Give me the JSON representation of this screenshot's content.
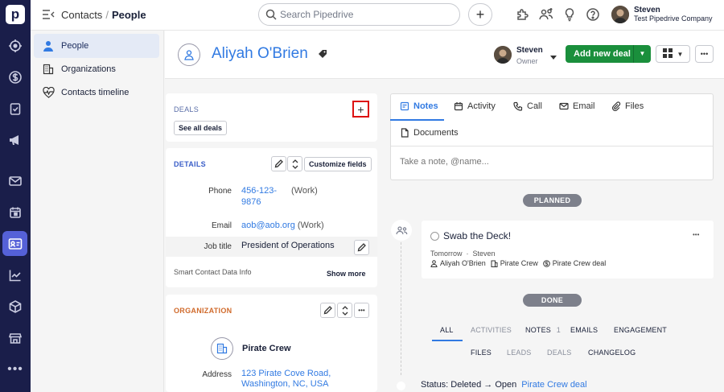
{
  "colors": {
    "rail_bg": "#1a1e4a",
    "rail_active": "#5561d8",
    "link_blue": "#317ae2",
    "primary_green": "#1a8f3c",
    "highlight_red": "#d11"
  },
  "rail": {
    "logo": "p",
    "icons": [
      "target-icon",
      "dollar-icon",
      "clipboard-check-icon",
      "megaphone-icon",
      "mail-icon",
      "calendar-icon",
      "contacts-card-icon",
      "chart-line-icon",
      "box-icon",
      "store-icon",
      "more-icon"
    ],
    "more": "•••"
  },
  "header": {
    "breadcrumb_parent": "Contacts",
    "breadcrumb_sep": "/",
    "breadcrumb_current": "People",
    "search_placeholder": "Search Pipedrive",
    "add_label": "+",
    "user_name": "Steven",
    "user_company": "Test Pipedrive Company"
  },
  "sidebar": {
    "items": [
      {
        "label": "People",
        "icon": "person-icon",
        "active": true
      },
      {
        "label": "Organizations",
        "icon": "building-icon",
        "active": false
      },
      {
        "label": "Contacts timeline",
        "icon": "heart-pulse-icon",
        "active": false
      }
    ]
  },
  "person": {
    "name": "Aliyah O'Brien",
    "owner_name": "Steven",
    "owner_role": "Owner",
    "add_deal_label": "Add new deal",
    "more_label": "•••"
  },
  "deals": {
    "title": "DEALS",
    "add": "+",
    "see_all": "See all deals"
  },
  "details": {
    "title": "DETAILS",
    "customize": "Customize fields",
    "phone_label": "Phone",
    "phone_value_line1": "456-123-",
    "phone_value_line2": "9876",
    "phone_type": "(Work)",
    "email_label": "Email",
    "email_value": "aob@aob.org",
    "email_type": "(Work)",
    "job_label": "Job title",
    "job_value": "President of Operations",
    "smart_label": "Smart Contact Data Info",
    "show_more": "Show more"
  },
  "organization": {
    "title": "ORGANIZATION",
    "name": "Pirate Crew",
    "address_label": "Address",
    "address_line1": "123 Pirate Cove Road,",
    "address_line2": "Washington, NC, USA"
  },
  "composer": {
    "tabs": [
      {
        "label": "Notes",
        "icon": "note-icon",
        "active": true
      },
      {
        "label": "Activity",
        "icon": "calendar-icon",
        "active": false
      },
      {
        "label": "Call",
        "icon": "phone-icon",
        "active": false
      },
      {
        "label": "Email",
        "icon": "envelope-icon",
        "active": false
      },
      {
        "label": "Files",
        "icon": "paperclip-icon",
        "active": false
      },
      {
        "label": "Documents",
        "icon": "document-icon",
        "active": false
      }
    ],
    "placeholder": "Take a note, @name..."
  },
  "timeline": {
    "planned_label": "PLANNED",
    "done_label": "DONE",
    "activity": {
      "title": "Swab the Deck!",
      "when": "Tomorrow",
      "dot": "·",
      "assignee": "Steven",
      "person": "Aliyah O'Brien",
      "org": "Pirate Crew",
      "deal": "Pirate Crew deal",
      "more": "•••"
    },
    "filters_row1": [
      {
        "label": "ALL",
        "active": true
      },
      {
        "label": "ACTIVITIES",
        "active": false
      },
      {
        "label": "NOTES",
        "count": "1",
        "active": true
      },
      {
        "label": "EMAILS",
        "active": true
      },
      {
        "label": "ENGAGEMENT",
        "active": true
      }
    ],
    "filters_row2": [
      {
        "label": "FILES",
        "active": true
      },
      {
        "label": "LEADS",
        "active": false
      },
      {
        "label": "DEALS",
        "active": false
      },
      {
        "label": "CHANGELOG",
        "active": true
      }
    ],
    "status_text": "Status: Deleted → Open",
    "status_link": "Pirate Crew deal"
  }
}
